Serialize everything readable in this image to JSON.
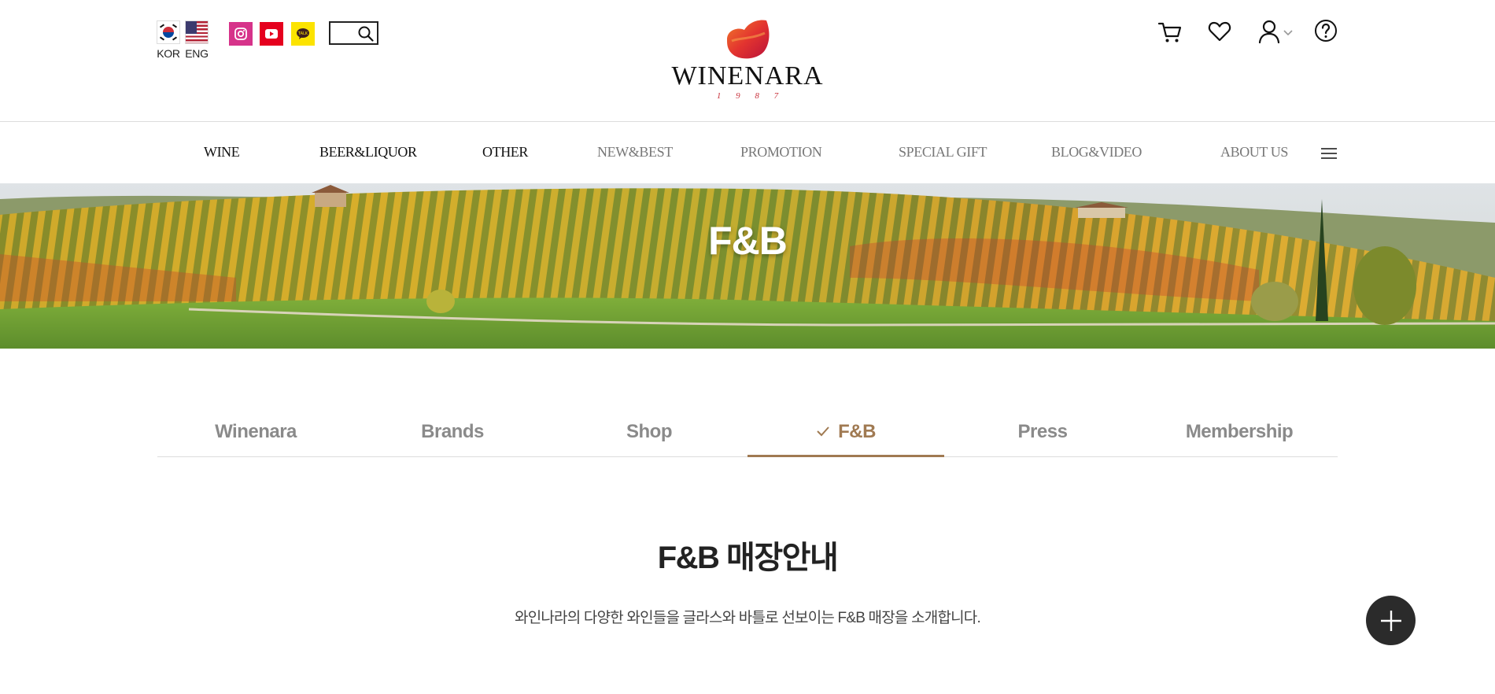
{
  "header": {
    "languages": [
      {
        "code": "KOR",
        "icon": "korea-flag-icon"
      },
      {
        "code": "ENG",
        "icon": "usa-flag-icon"
      }
    ],
    "social": [
      {
        "name": "instagram",
        "icon": "instagram-icon",
        "color": "#d6338a"
      },
      {
        "name": "youtube",
        "icon": "youtube-icon",
        "color": "#e5001e"
      },
      {
        "name": "kakaotalk",
        "icon": "kakao-chat-icon",
        "color": "#fce300"
      }
    ],
    "search": {
      "placeholder": "",
      "icon": "search-icon"
    },
    "logo": {
      "name": "WINENARA",
      "year": "1 9 8 7",
      "mark_colors": [
        "#e8442a",
        "#c4133a"
      ]
    },
    "utilities": [
      {
        "name": "cart",
        "icon": "cart-icon"
      },
      {
        "name": "wishlist",
        "icon": "heart-icon"
      },
      {
        "name": "account",
        "icon": "user-icon"
      },
      {
        "name": "help",
        "icon": "help-icon"
      }
    ]
  },
  "gnb": {
    "items": [
      {
        "label": "WINE"
      },
      {
        "label": "BEER&LIQUOR"
      },
      {
        "label": "OTHER"
      },
      {
        "label": "NEW&BEST"
      },
      {
        "label": "PROMOTION"
      },
      {
        "label": "SPECIAL GIFT"
      },
      {
        "label": "BLOG&VIDEO"
      },
      {
        "label": "ABOUT US"
      }
    ],
    "menu_icon": "hamburger-menu-icon"
  },
  "banner": {
    "title": "F&B"
  },
  "tabs": {
    "items": [
      {
        "label": "Winenara"
      },
      {
        "label": "Brands"
      },
      {
        "label": "Shop"
      },
      {
        "label": "F&B"
      },
      {
        "label": "Press"
      },
      {
        "label": "Membership"
      }
    ],
    "active_index": 3,
    "accent_color": "#a07a52"
  },
  "content": {
    "title": "F&B 매장안내",
    "description": "와인나라의 다양한 와인들을 글라스와 바틀로 선보이는 F&B 매장을 소개합니다."
  },
  "fab": {
    "icon": "plus-icon"
  }
}
